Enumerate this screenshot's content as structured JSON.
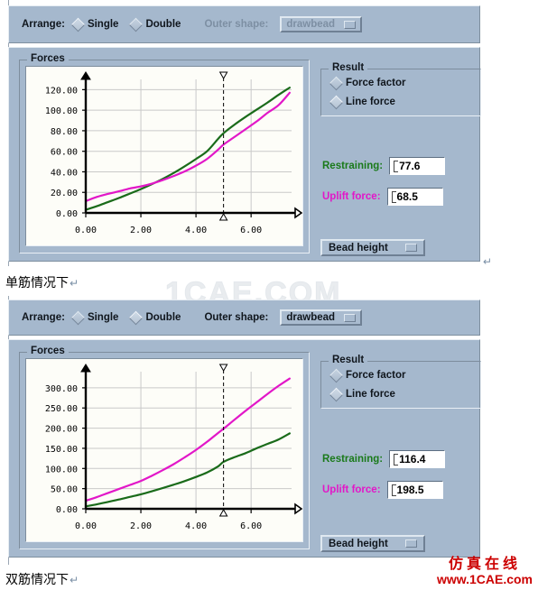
{
  "page": {
    "watermark_center": "1CAE.COM",
    "logo_cn": "仿真在线",
    "logo_url": "www.1CAE.com",
    "pilcrow": "↵"
  },
  "captions": {
    "first": "单筋情况下",
    "second": "双筋情况下"
  },
  "panels": [
    {
      "id": "single-bead",
      "toolbar": {
        "arrange_label": "Arrange:",
        "options": [
          {
            "label": "Single",
            "selected": true
          },
          {
            "label": "Double",
            "selected": false
          }
        ],
        "outer_shape_label": "Outer shape:",
        "outer_shape_value": "drawbead",
        "disabled": true
      },
      "forces_group_title": "Forces",
      "result": {
        "group_title": "Result",
        "options": [
          {
            "label": "Force factor",
            "selected": false
          },
          {
            "label": "Line force",
            "selected": true
          }
        ],
        "fields": [
          {
            "label": "Restraining:",
            "value": "77.6",
            "color": "#1a7a1a"
          },
          {
            "label": "Uplift force:",
            "value": "68.5",
            "color": "#e217c8"
          }
        ],
        "button": {
          "label": "Bead height"
        }
      },
      "chart_data": {
        "type": "line",
        "title": "Forces",
        "xlabel": "",
        "ylabel": "",
        "xlim": [
          0,
          7.6
        ],
        "ylim": [
          0,
          130
        ],
        "xticks": [
          "0.00",
          "2.00",
          "4.00",
          "6.00"
        ],
        "xtick_values": [
          0,
          2,
          4,
          6
        ],
        "yticks": [
          "0.00",
          "20.00",
          "40.00",
          "60.00",
          "80.00",
          "100.00",
          "120.00"
        ],
        "ytick_values": [
          0,
          20,
          40,
          60,
          80,
          100,
          120
        ],
        "grid": true,
        "legend": "none",
        "cursor_x": 5.0,
        "series": [
          {
            "name": "Restraining",
            "color": "#1a6b1a",
            "x": [
              0,
              0.4,
              0.8,
              1.2,
              1.6,
              2.0,
              2.4,
              2.8,
              3.2,
              3.6,
              4.0,
              4.4,
              4.8,
              5.0,
              5.4,
              5.8,
              6.2,
              6.6,
              7.0,
              7.4
            ],
            "y": [
              3.0,
              6.5,
              10.5,
              14.5,
              18.8,
              23.2,
              28.0,
              33.2,
              39.0,
              45.5,
              52.5,
              60.0,
              72.0,
              77.6,
              86.0,
              93.5,
              100.5,
              107.5,
              115.0,
              122.0
            ]
          },
          {
            "name": "Uplift force",
            "color": "#e217c8",
            "x": [
              0,
              0.4,
              0.8,
              1.2,
              1.6,
              2.0,
              2.4,
              2.8,
              3.2,
              3.6,
              4.0,
              4.4,
              4.8,
              5.0,
              5.4,
              5.8,
              6.2,
              6.6,
              7.0,
              7.4
            ],
            "y": [
              11.5,
              15.5,
              18.5,
              21.0,
              23.8,
              25.8,
              28.5,
              32.0,
              36.0,
              40.5,
              46.0,
              52.5,
              61.5,
              66.5,
              74.0,
              81.5,
              89.0,
              97.5,
              105.0,
              117.0
            ]
          }
        ]
      }
    },
    {
      "id": "double-bead",
      "toolbar": {
        "arrange_label": "Arrange:",
        "options": [
          {
            "label": "Single",
            "selected": false
          },
          {
            "label": "Double",
            "selected": true
          }
        ],
        "outer_shape_label": "Outer shape:",
        "outer_shape_value": "drawbead",
        "disabled": false
      },
      "forces_group_title": "Forces",
      "result": {
        "group_title": "Result",
        "options": [
          {
            "label": "Force factor",
            "selected": false
          },
          {
            "label": "Line force",
            "selected": true
          }
        ],
        "fields": [
          {
            "label": "Restraining:",
            "value": "116.4",
            "color": "#1a7a1a"
          },
          {
            "label": "Uplift force:",
            "value": "198.5",
            "color": "#e217c8"
          }
        ],
        "button": {
          "label": "Bead height"
        }
      },
      "chart_data": {
        "type": "line",
        "title": "Forces",
        "xlabel": "",
        "ylabel": "",
        "xlim": [
          0,
          7.6
        ],
        "ylim": [
          0,
          340
        ],
        "xticks": [
          "0.00",
          "2.00",
          "4.00",
          "6.00"
        ],
        "xtick_values": [
          0,
          2,
          4,
          6
        ],
        "yticks": [
          "0.00",
          "50.00",
          "100.00",
          "150.00",
          "200.00",
          "250.00",
          "300.00"
        ],
        "ytick_values": [
          0,
          50,
          100,
          150,
          200,
          250,
          300
        ],
        "grid": true,
        "legend": "none",
        "cursor_x": 5.0,
        "series": [
          {
            "name": "Restraining",
            "color": "#1a6b1a",
            "x": [
              0,
              0.4,
              0.8,
              1.2,
              1.6,
              2.0,
              2.4,
              2.8,
              3.2,
              3.6,
              4.0,
              4.4,
              4.8,
              5.0,
              5.4,
              5.8,
              6.2,
              6.6,
              7.0,
              7.4
            ],
            "y": [
              6.0,
              11.0,
              17.0,
              23.0,
              29.5,
              36.0,
              43.5,
              51.5,
              60.0,
              69.0,
              79.0,
              90.0,
              105.0,
              116.4,
              128.0,
              138.0,
              150.0,
              161.0,
              172.0,
              187.0
            ]
          },
          {
            "name": "Uplift force",
            "color": "#e217c8",
            "x": [
              0,
              0.4,
              0.8,
              1.2,
              1.6,
              2.0,
              2.4,
              2.8,
              3.2,
              3.6,
              4.0,
              4.4,
              4.8,
              5.0,
              5.4,
              5.8,
              6.2,
              6.6,
              7.0,
              7.4
            ],
            "y": [
              20.0,
              29.0,
              39.0,
              49.0,
              59.0,
              69.0,
              82.0,
              96.0,
              111.0,
              128.0,
              146.0,
              166.0,
              188.0,
              198.5,
              221.0,
              243.0,
              264.0,
              285.0,
              305.0,
              323.0
            ]
          }
        ]
      }
    }
  ]
}
